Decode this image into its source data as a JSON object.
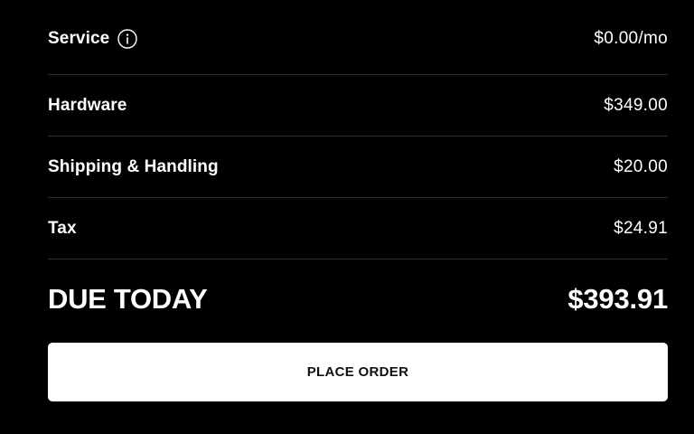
{
  "line_items": [
    {
      "label": "Service",
      "amount": "$0.00/mo",
      "icon": "info-icon"
    },
    {
      "label": "Hardware",
      "amount": "$349.00"
    },
    {
      "label": "Shipping & Handling",
      "amount": "$20.00"
    },
    {
      "label": "Tax",
      "amount": "$24.91"
    }
  ],
  "total": {
    "label": "DUE TODAY",
    "amount": "$393.91"
  },
  "actions": {
    "place_order_label": "PLACE ORDER"
  },
  "colors": {
    "background": "#000000",
    "text": "#ffffff",
    "divider": "#2e2e2e",
    "button_bg": "#ffffff",
    "button_text": "#111111"
  }
}
